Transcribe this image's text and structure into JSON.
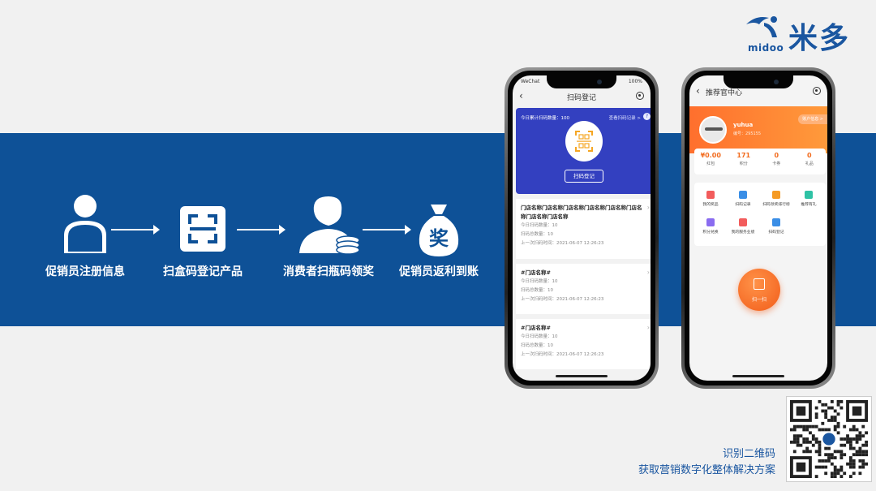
{
  "brand": {
    "name_cn": "米多",
    "name_en": "midoo",
    "color": "#1a56a0"
  },
  "colors": {
    "band": "#0e5197",
    "phone1_accent": "#3340c0",
    "phone2_accent": "#ff7a30"
  },
  "process": [
    {
      "icon": "person-icon",
      "label": "促销员注册信息"
    },
    {
      "icon": "scan-frame-icon",
      "label": "扫盒码登记产品"
    },
    {
      "icon": "consumer-coin-icon",
      "label": "消费者扫瓶码领奖"
    },
    {
      "icon": "money-bag-icon",
      "label": "促销员返利到账"
    }
  ],
  "phone1": {
    "status_left": "WeChat",
    "status_right": "100%",
    "title": "扫码登记",
    "today_count": "今日累计扫码数量：100",
    "records_link": "查看扫码记录 >",
    "help": "?",
    "scan_button": "扫码登记",
    "cards": [
      {
        "title": "门店名称门店名称门店名称门店名称门店名称门店名称门店名称门店名称",
        "today": "今日扫码数量：10",
        "total": "扫码总数量：10",
        "last": "上一次扫码时间：2021-06-07 12:26:23"
      },
      {
        "title": "#门店名称#",
        "today": "今日扫码数量：10",
        "total": "扫码总数量：10",
        "last": "上一次扫码时间：2021-06-07 12:26:23"
      },
      {
        "title": "#门店名称#",
        "today": "今日扫码数量：10",
        "total": "扫码总数量：10",
        "last": "上一次扫码时间：2021-06-07 12:26:23"
      }
    ]
  },
  "phone2": {
    "title": "推荐官中心",
    "username": "yuhua",
    "user_no": "编号：295155",
    "account_tag": "账户信息 >",
    "stats": [
      {
        "value": "¥0.00",
        "label": "红包"
      },
      {
        "value": "171",
        "label": "积分"
      },
      {
        "value": "0",
        "label": "卡券"
      },
      {
        "value": "0",
        "label": "礼品"
      }
    ],
    "menu": [
      {
        "label": "我的奖品",
        "color": "#f25c5c",
        "icon": "gift-icon"
      },
      {
        "label": "扫码记录",
        "color": "#3a8ee6",
        "icon": "record-icon"
      },
      {
        "label": "扫码领奖排行榜",
        "color": "#f59a23",
        "icon": "rank-icon"
      },
      {
        "label": "推荐有礼",
        "color": "#2fc2a5",
        "icon": "share-icon"
      },
      {
        "label": "积分兑换",
        "color": "#8a6cf0",
        "icon": "points-icon"
      },
      {
        "label": "我的服务业绩",
        "color": "#f25c5c",
        "icon": "chart-icon"
      },
      {
        "label": "扫码登记",
        "color": "#3a8ee6",
        "icon": "scan-icon"
      }
    ],
    "scan_label": "扫一扫"
  },
  "footer": {
    "line1": "识别二维码",
    "line2": "获取营销数字化整体解决方案"
  }
}
